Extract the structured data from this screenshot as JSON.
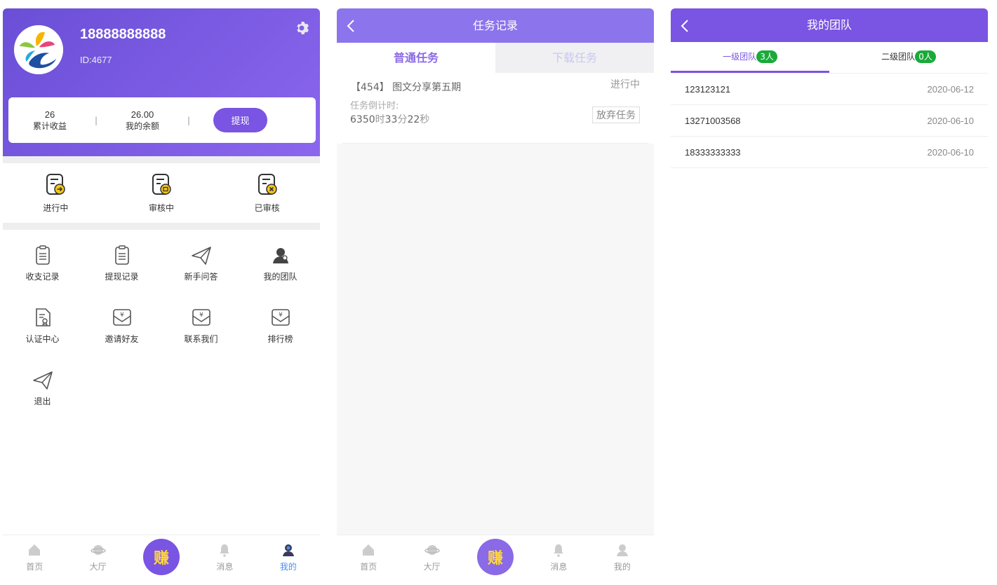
{
  "panel1": {
    "phone": "18888888888",
    "uid": "ID:4677",
    "stats": {
      "total_income_value": "26",
      "total_income_label": "累计收益",
      "balance_value": "26.00",
      "balance_label": "我的余额",
      "divider": "|",
      "withdraw_label": "提现"
    },
    "status_items": [
      {
        "label": "进行中",
        "icon": "task-in-progress-icon"
      },
      {
        "label": "审核中",
        "icon": "task-reviewing-icon"
      },
      {
        "label": "已审核",
        "icon": "task-reviewed-icon"
      }
    ],
    "menu": [
      {
        "label": "收支记录",
        "icon": "clipboard-icon"
      },
      {
        "label": "提现记录",
        "icon": "clipboard-icon"
      },
      {
        "label": "新手问答",
        "icon": "paper-plane-icon"
      },
      {
        "label": "我的团队",
        "icon": "team-user-icon"
      },
      {
        "label": "认证中心",
        "icon": "certificate-icon"
      },
      {
        "label": "邀请好友",
        "icon": "yen-envelope-icon"
      },
      {
        "label": "联系我们",
        "icon": "yen-envelope-icon"
      },
      {
        "label": "排行榜",
        "icon": "yen-envelope-icon"
      },
      {
        "label": "退出",
        "icon": "paper-plane-icon"
      }
    ]
  },
  "tabbar": {
    "home": "首页",
    "hall": "大厅",
    "earn": "赚",
    "messages": "消息",
    "mine": "我的"
  },
  "panel2": {
    "title": "任务记录",
    "tabs": {
      "normal": "普通任务",
      "download": "下载任务"
    },
    "task": {
      "title": "【454】 图文分享第五期",
      "status": "进行中",
      "countdown_label": "任务倒计时:",
      "hours": "6350",
      "hours_unit": "时",
      "minutes": "33",
      "minutes_unit": "分",
      "seconds": "22",
      "seconds_unit": "秒",
      "abandon": "放弃任务"
    }
  },
  "panel3": {
    "title": "我的团队",
    "tabs": {
      "level1_label": "一级团队",
      "level1_count": "3人",
      "level2_label": "二级团队",
      "level2_count": "0人"
    },
    "members": [
      {
        "id": "123123121",
        "date": "2020-06-12"
      },
      {
        "id": "13271003568",
        "date": "2020-06-10"
      },
      {
        "id": "18333333333",
        "date": "2020-06-10"
      }
    ]
  },
  "colors": {
    "accent": "#7a54e2",
    "badge": "#1aaa3a",
    "tab_active": "#4a8df0",
    "earn_text": "#ffd83b"
  }
}
